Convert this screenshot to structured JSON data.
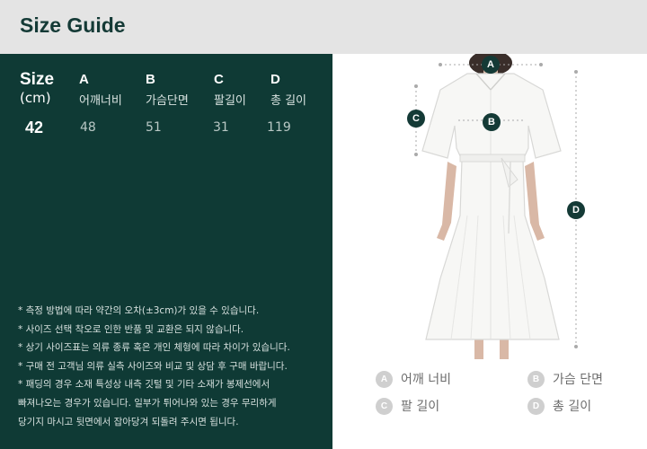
{
  "header": {
    "title": "Size Guide"
  },
  "table": {
    "size_label": "Size",
    "unit_label": "(cm)",
    "columns": [
      {
        "letter": "A",
        "name": "어깨너비"
      },
      {
        "letter": "B",
        "name": "가슴단면"
      },
      {
        "letter": "C",
        "name": "팔길이"
      },
      {
        "letter": "D",
        "name": "총 길이"
      }
    ],
    "size": "42",
    "values": [
      "48",
      "51",
      "31",
      "119"
    ]
  },
  "notes": [
    "* 측정 방법에 따라 약간의 오차(±3cm)가 있을 수 있습니다.",
    "* 사이즈 선택 착오로 인한 반품 및 교환은 되지 않습니다.",
    "* 상기 사이즈표는 의류 종류 혹은 개인 체형에 따라 차이가 있습니다.",
    "* 구매 전 고객님 의류 실측 사이즈와 비교 및 상담 후 구매 바랍니다.",
    "* 패딩의 경우 소재 특성상 내측 깃털 및 기타 소재가 봉제선에서",
    "빠져나오는 경우가 있습니다. 일부가 튀어나와 있는 경우 무리하게",
    "당기지 마시고 뒷면에서 잡아당겨 되돌려 주시면 됩니다."
  ],
  "markers": {
    "a": "A",
    "b": "B",
    "c": "C",
    "d": "D"
  },
  "legend": [
    {
      "letter": "A",
      "label": "어깨 너비"
    },
    {
      "letter": "B",
      "label": "가슴 단면"
    },
    {
      "letter": "C",
      "label": "팔 길이"
    },
    {
      "letter": "D",
      "label": "총 길이"
    }
  ],
  "colors": {
    "accent": "#0f3a35",
    "header_bg": "#e4e4e4",
    "legend_dot": "#cfcfcf"
  }
}
